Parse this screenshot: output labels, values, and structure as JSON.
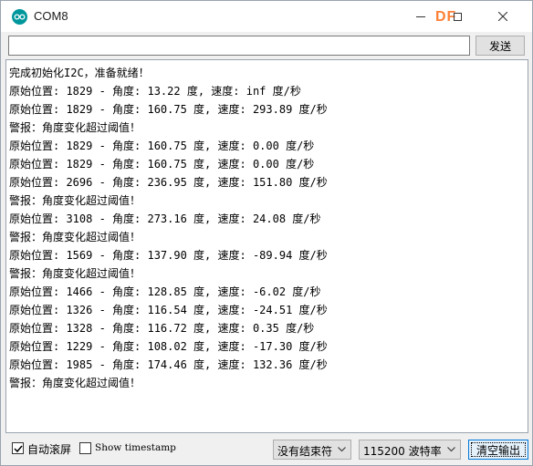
{
  "window": {
    "title": "COM8",
    "watermark": "DF"
  },
  "send_bar": {
    "input_value": "",
    "send_label": "发送"
  },
  "output_lines": [
    "完成初始化I2C，准备就绪！",
    "原始位置: 1829 - 角度: 13.22 度, 速度: inf 度/秒",
    "原始位置: 1829 - 角度: 160.75 度, 速度: 293.89 度/秒",
    "警报：角度变化超过阈值！",
    "原始位置: 1829 - 角度: 160.75 度, 速度: 0.00 度/秒",
    "原始位置: 1829 - 角度: 160.75 度, 速度: 0.00 度/秒",
    "原始位置: 2696 - 角度: 236.95 度, 速度: 151.80 度/秒",
    "警报：角度变化超过阈值！",
    "原始位置: 3108 - 角度: 273.16 度, 速度: 24.08 度/秒",
    "警报：角度变化超过阈值！",
    "原始位置: 1569 - 角度: 137.90 度, 速度: -89.94 度/秒",
    "警报：角度变化超过阈值！",
    "原始位置: 1466 - 角度: 128.85 度, 速度: -6.02 度/秒",
    "原始位置: 1326 - 角度: 116.54 度, 速度: -24.51 度/秒",
    "原始位置: 1328 - 角度: 116.72 度, 速度: 0.35 度/秒",
    "原始位置: 1229 - 角度: 108.02 度, 速度: -17.30 度/秒",
    "原始位置: 1985 - 角度: 174.46 度, 速度: 132.36 度/秒",
    "警报：角度变化超过阈值！"
  ],
  "bottom_bar": {
    "autoscroll": {
      "label": "自动滚屏",
      "checked": true
    },
    "timestamp": {
      "label": "Show timestamp",
      "checked": false
    },
    "line_ending": "没有结束符",
    "baud_rate": "115200 波特率",
    "clear_label": "清空输出"
  },
  "icons": {
    "app": "arduino-logo-icon",
    "minimize": "minimize-icon",
    "maximize": "maximize-icon",
    "close": "close-icon",
    "dropdown": "chevron-down-icon",
    "check": "checkmark-icon"
  },
  "colors": {
    "accent": "#00979c",
    "focus_border": "#0078d7",
    "watermark": "#ff6a13"
  }
}
